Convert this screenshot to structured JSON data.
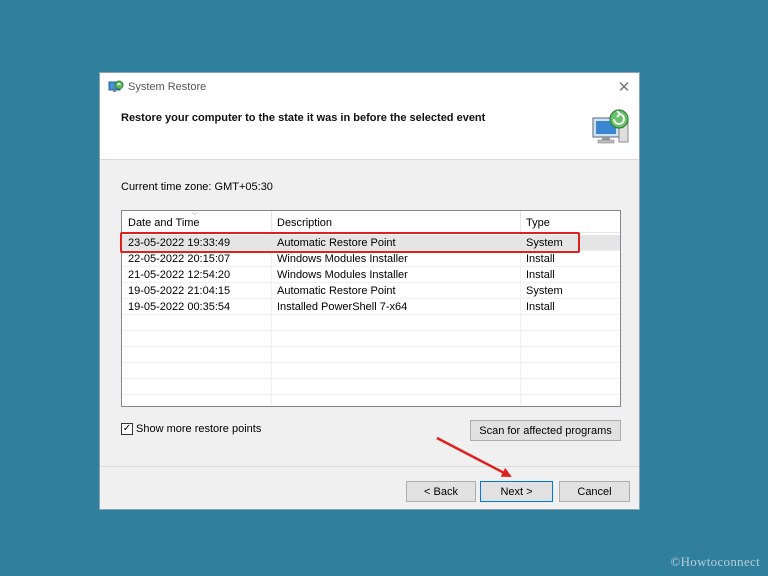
{
  "window": {
    "title": "System Restore",
    "close_glyph": "✕"
  },
  "header": {
    "heading": "Restore your computer to the state it was in before the selected event"
  },
  "timezone": "Current time zone: GMT+05:30",
  "table": {
    "columns": [
      "Date and Time",
      "Description",
      "Type"
    ],
    "rows": [
      {
        "date": "23-05-2022 19:33:49",
        "description": "Automatic Restore Point",
        "type": "System"
      },
      {
        "date": "22-05-2022 20:15:07",
        "description": "Windows Modules Installer",
        "type": "Install"
      },
      {
        "date": "21-05-2022 12:54:20",
        "description": "Windows Modules Installer",
        "type": "Install"
      },
      {
        "date": "19-05-2022 21:04:15",
        "description": "Automatic Restore Point",
        "type": "System"
      },
      {
        "date": "19-05-2022 00:35:54",
        "description": "Installed PowerShell 7-x64",
        "type": "Install"
      }
    ],
    "selected_row": 0
  },
  "show_more": {
    "label": "Show more restore points",
    "checked": true,
    "check_glyph": "✓"
  },
  "buttons": {
    "scan": "Scan for affected programs",
    "back": "< Back",
    "next": "Next >",
    "cancel": "Cancel"
  },
  "watermark": "©Howtoconnect",
  "colors": {
    "background": "#2f7f9d",
    "highlight": "#e0201c"
  },
  "icons": {
    "app": "system-restore-icon",
    "header": "restore-computer-icon"
  }
}
